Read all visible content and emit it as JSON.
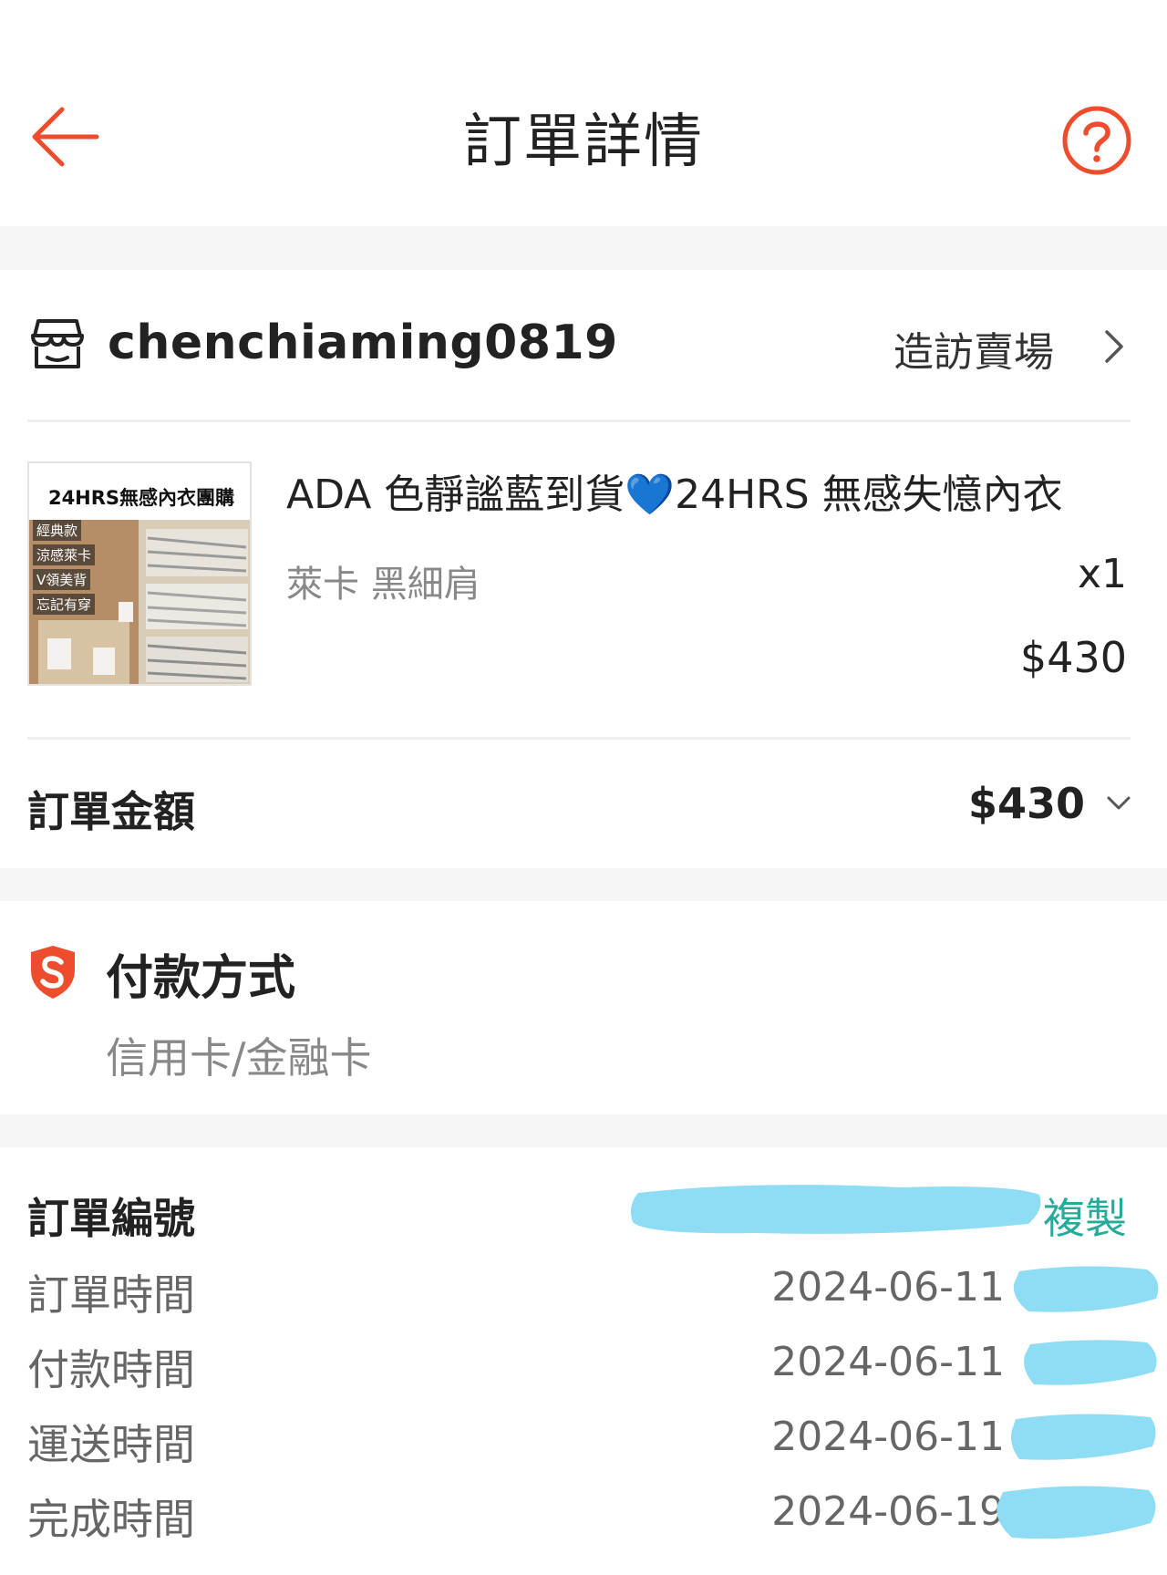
{
  "header": {
    "title": "訂單詳情",
    "back_icon": "arrow-left-icon",
    "help_icon": "question-circle-icon",
    "accent_color": "#ee4d2d"
  },
  "shop": {
    "icon": "shop-icon",
    "name": "chenchiaming0819",
    "visit_label": "造訪賣場"
  },
  "product": {
    "thumbnail_title": "24HRS無感內衣團購",
    "thumbnail_tags": [
      "經典款",
      "涼感萊卡",
      "V領美背",
      "忘記有穿"
    ],
    "name": "ADA 色靜謐藍到貨💙24HRS 無感失憶內衣",
    "variant": "萊卡 黑細肩",
    "quantity": "x1",
    "price": "$430"
  },
  "order_total": {
    "label": "訂單金額",
    "value": "$430"
  },
  "payment": {
    "icon": "shield-s-icon",
    "title": "付款方式",
    "method": "信用卡/金融卡"
  },
  "order_info": {
    "order_number_label": "訂單編號",
    "copy_label": "複製",
    "copy_color": "#26aa99",
    "redaction_color": "#8fdcf5",
    "rows": [
      {
        "label": "訂單時間",
        "value": "2024-06-11"
      },
      {
        "label": "付款時間",
        "value": "2024-06-11"
      },
      {
        "label": "運送時間",
        "value": "2024-06-11"
      },
      {
        "label": "完成時間",
        "value": "2024-06-19"
      }
    ]
  }
}
